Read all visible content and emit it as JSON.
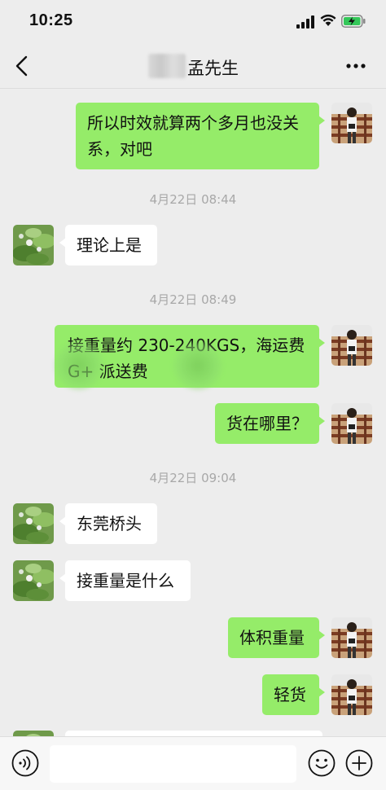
{
  "status_bar": {
    "time": "10:25"
  },
  "header": {
    "contact_name": "孟先生"
  },
  "messages": [
    {
      "side": "me",
      "text": "所以时效就算两个多月也没关系，对吧"
    },
    {
      "timestamp": "4月22日 08:44"
    },
    {
      "side": "them",
      "text": "理论上是"
    },
    {
      "timestamp": "4月22日 08:49"
    },
    {
      "side": "me",
      "text": "接重量约 230-240KGS，海运费 G+ 派送费"
    },
    {
      "side": "me",
      "text": "货在哪里？"
    },
    {
      "timestamp": "4月22日 09:04"
    },
    {
      "side": "them",
      "text": "东莞桥头"
    },
    {
      "side": "them",
      "text": "接重量是什么"
    },
    {
      "side": "me",
      "text": "体积重量"
    },
    {
      "side": "me",
      "text": "轻货"
    }
  ],
  "input": {
    "value": ""
  },
  "colors": {
    "my_bubble": "#95ec69",
    "their_bubble": "#ffffff",
    "background": "#ededed"
  },
  "icons": [
    "signal-icon",
    "wifi-icon",
    "battery-icon",
    "back-icon",
    "more-icon",
    "voice-icon",
    "emoji-icon",
    "plus-icon"
  ]
}
